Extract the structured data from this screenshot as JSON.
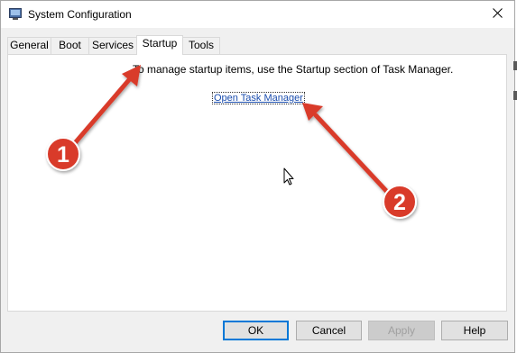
{
  "window": {
    "title": "System Configuration",
    "app_icon": "msconfig-icon",
    "close_icon": "close-icon"
  },
  "tabs": [
    {
      "label": "General",
      "active": false
    },
    {
      "label": "Boot",
      "active": false
    },
    {
      "label": "Services",
      "active": false
    },
    {
      "label": "Startup",
      "active": true
    },
    {
      "label": "Tools",
      "active": false
    }
  ],
  "startup": {
    "message": "To manage startup items, use the Startup section of Task Manager.",
    "link_label": "Open Task Manager"
  },
  "buttons": {
    "ok": "OK",
    "cancel": "Cancel",
    "apply": "Apply",
    "help": "Help"
  },
  "annotations": {
    "marker_1": "1",
    "marker_2": "2",
    "color": "#d93a2b"
  },
  "colors": {
    "link": "#1a4dae",
    "focus_border": "#0078d7"
  }
}
